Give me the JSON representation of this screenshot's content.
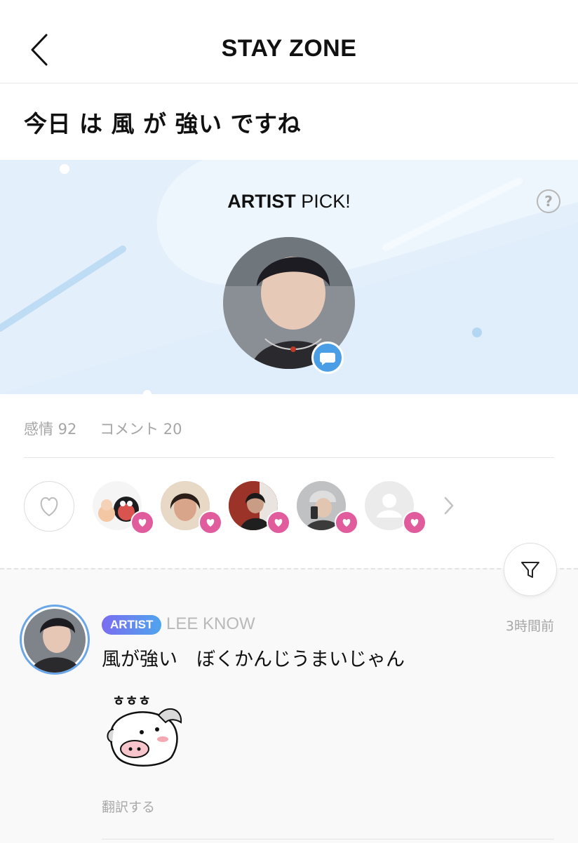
{
  "header": {
    "title": "STAY ZONE",
    "back_icon": "chevron-left-icon"
  },
  "post": {
    "title": "今日 は 風 が 強い ですね"
  },
  "banner": {
    "pick_bold": "ARTIST",
    "pick_rest": " PICK!",
    "help_label": "?",
    "accent_color": "#4a9ee6",
    "background_color": "#e3f0fb"
  },
  "stats": {
    "emotion": "感情 92",
    "comments": "コメント 20"
  },
  "reactions": {
    "like_icon": "heart-outline-icon",
    "heart_color": "#e05c9c",
    "more_icon": "chevron-right-icon"
  },
  "comment": {
    "badge": "ARTIST",
    "author": "LEE KNOW",
    "time": "3時間前",
    "text": "風が強い　ぼくかんじうまいじゃん",
    "sticker_text": "ㅎㅎㅎ",
    "translate": "翻訳する"
  },
  "filter_icon": "filter-icon"
}
